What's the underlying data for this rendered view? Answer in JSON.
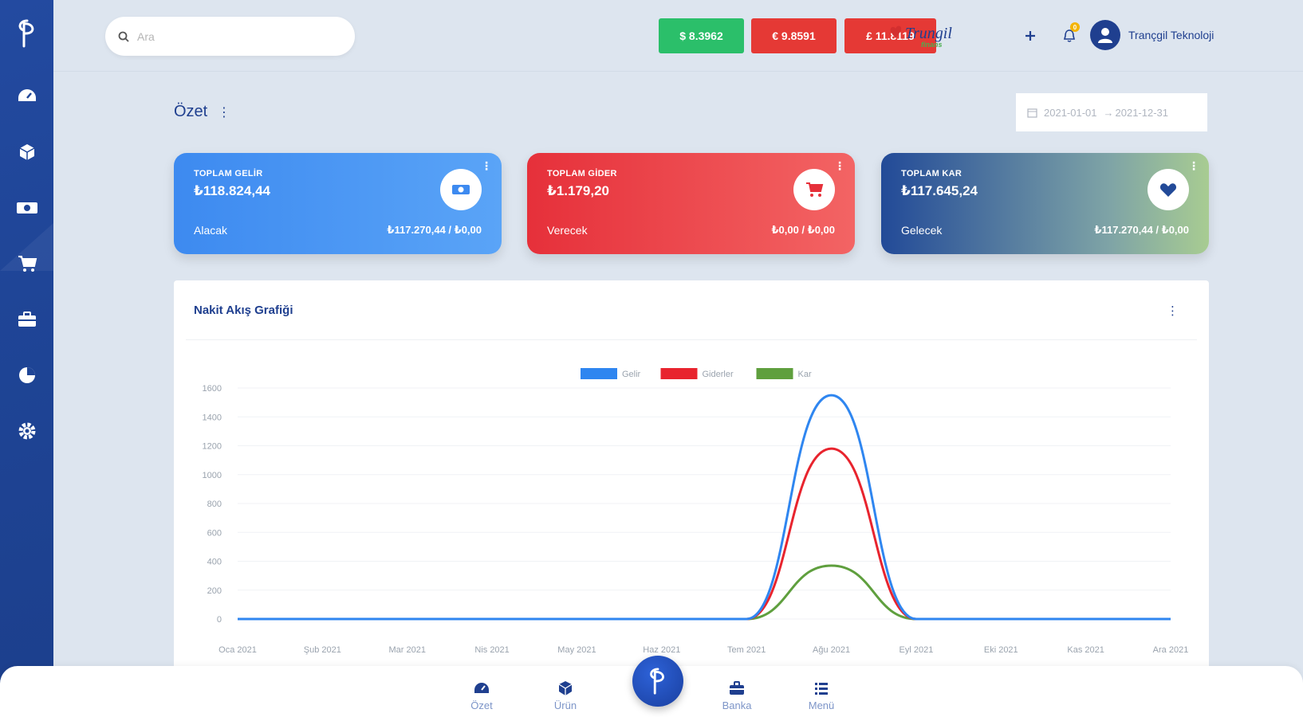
{
  "search": {
    "placeholder": "Ara"
  },
  "rates": [
    {
      "label": "$ 8.3962",
      "color": "#2bbf6a"
    },
    {
      "label": "€ 9.8591",
      "color": "#e53935"
    },
    {
      "label": "£ 11.8119",
      "color": "#e53935"
    }
  ],
  "brand": {
    "name": "Trungil",
    "sub": "finans"
  },
  "notifications": {
    "count": "0"
  },
  "user": {
    "name": "Trançgil Teknoloji"
  },
  "page": {
    "title": "Özet",
    "date_range_start": "2021-01-01",
    "date_range_end": "2021-12-31",
    "date_range_sep": "→"
  },
  "cards": {
    "income": {
      "label": "TOPLAM GELİR",
      "value": "₺118.824,44",
      "sub_label": "Alacak",
      "sub_value": "₺117.270,44 / ₺0,00"
    },
    "expense": {
      "label": "TOPLAM GİDER",
      "value": "₺1.179,20",
      "sub_label": "Verecek",
      "sub_value": "₺0,00 / ₺0,00"
    },
    "profit": {
      "label": "TOPLAM KAR",
      "value": "₺117.645,24",
      "sub_label": "Gelecek",
      "sub_value": "₺117.270,44 / ₺0,00"
    }
  },
  "panel": {
    "title": "Nakit Akış Grafiği"
  },
  "chart_data": {
    "type": "line",
    "title": "",
    "xlabel": "",
    "ylabel": "",
    "x": [
      "Oca 2021",
      "Şub 2021",
      "Mar 2021",
      "Nis 2021",
      "May 2021",
      "Haz 2021",
      "Tem 2021",
      "Ağu 2021",
      "Eyl 2021",
      "Eki 2021",
      "Kas 2021",
      "Ara 2021"
    ],
    "yticks": [
      0,
      200,
      400,
      600,
      800,
      1000,
      1200,
      1400,
      1600
    ],
    "ylim": [
      0,
      1600
    ],
    "grid": true,
    "legend": "top-center",
    "series": [
      {
        "name": "Gelir",
        "color": "#2f86f0",
        "values": [
          0,
          0,
          0,
          0,
          0,
          0,
          0,
          1550,
          0,
          0,
          0,
          0
        ]
      },
      {
        "name": "Giderler",
        "color": "#e8242e",
        "values": [
          0,
          0,
          0,
          0,
          0,
          0,
          0,
          1180,
          0,
          0,
          0,
          0
        ]
      },
      {
        "name": "Kar",
        "color": "#5f9f3e",
        "values": [
          0,
          0,
          0,
          0,
          0,
          0,
          0,
          370,
          0,
          0,
          0,
          0
        ]
      }
    ]
  },
  "nav": {
    "summary": "Özet",
    "product": "Ürün",
    "bank": "Banka",
    "menu": "Menü"
  },
  "colors": {
    "primary": "#1f3f8f",
    "background": "#dde5ef"
  }
}
